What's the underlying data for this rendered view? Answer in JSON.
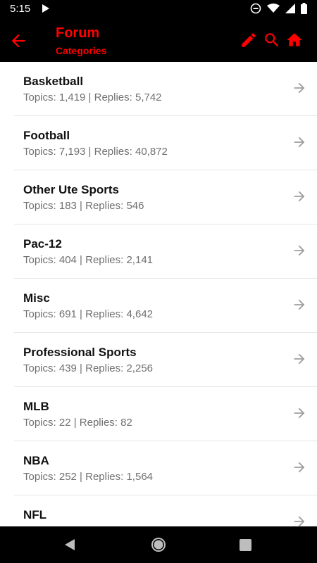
{
  "status": {
    "time": "5:15"
  },
  "header": {
    "title": "Forum",
    "subtitle": "Categories"
  },
  "colors": {
    "accent": "#ff0000",
    "bar": "#000000",
    "arrow": "#9e9e9e",
    "stats": "#707070"
  },
  "icons": {
    "back": "arrow-left-icon",
    "edit": "pencil-icon",
    "search": "search-icon",
    "home": "home-icon",
    "row": "arrow-right-icon"
  },
  "categories": [
    {
      "name": "Basketball",
      "stats": "Topics: 1,419 | Replies: 5,742"
    },
    {
      "name": "Football",
      "stats": "Topics: 7,193 | Replies: 40,872"
    },
    {
      "name": "Other Ute Sports",
      "stats": "Topics: 183 | Replies: 546"
    },
    {
      "name": "Pac-12",
      "stats": "Topics: 404 | Replies: 2,141"
    },
    {
      "name": "Misc",
      "stats": "Topics: 691 | Replies: 4,642"
    },
    {
      "name": "Professional Sports",
      "stats": "Topics: 439 | Replies: 2,256"
    },
    {
      "name": "MLB",
      "stats": "Topics: 22 | Replies: 82"
    },
    {
      "name": "NBA",
      "stats": "Topics: 252 | Replies: 1,564"
    },
    {
      "name": "NFL",
      "stats": ""
    }
  ]
}
